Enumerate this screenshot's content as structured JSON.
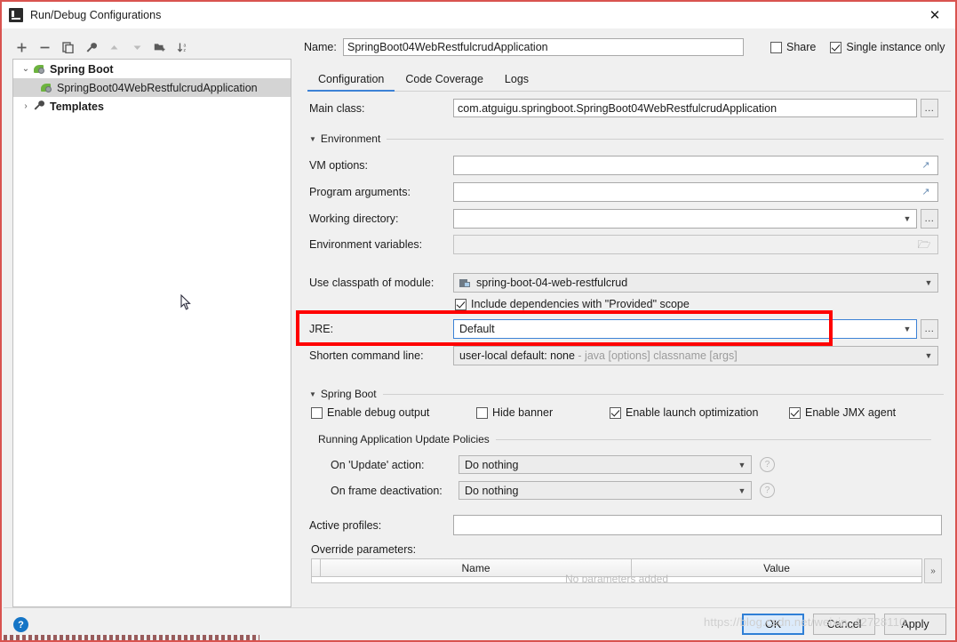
{
  "window": {
    "title": "Run/Debug Configurations",
    "app_icon": "intellij-idea-icon",
    "close_label": "✕"
  },
  "left_panel": {
    "toolbar": [
      {
        "name": "add-button",
        "glyph": "+"
      },
      {
        "name": "remove-button",
        "glyph": "−"
      },
      {
        "name": "copy-button",
        "glyph": "❐"
      },
      {
        "name": "edit-templates-button",
        "glyph": "🔧"
      },
      {
        "name": "move-up-button",
        "glyph": "▲"
      },
      {
        "name": "move-down-button",
        "glyph": "▼"
      },
      {
        "name": "new-folder-button",
        "glyph": "⬛"
      },
      {
        "name": "sort-button",
        "glyph": "↓"
      }
    ],
    "tree": [
      {
        "label": "Spring Boot",
        "icon": "spring-boot-icon",
        "twisty": "⌄",
        "bold": true,
        "selected": false,
        "indent": false
      },
      {
        "label": "SpringBoot04WebRestfulcrudApplication",
        "icon": "spring-boot-icon",
        "twisty": "",
        "bold": false,
        "selected": true,
        "indent": true
      },
      {
        "label": "Templates",
        "icon": "wrench-icon",
        "twisty": "›",
        "bold": true,
        "selected": false,
        "indent": false
      }
    ]
  },
  "name_row": {
    "label": "Name:",
    "value": "SpringBoot04WebRestfulcrudApplication",
    "share": {
      "label": "Share",
      "checked": false
    },
    "single_instance": {
      "label": "Single instance only",
      "checked": true
    }
  },
  "tabs": [
    {
      "label": "Configuration",
      "active": true
    },
    {
      "label": "Code Coverage",
      "active": false
    },
    {
      "label": "Logs",
      "active": false
    }
  ],
  "configuration": {
    "main_class": {
      "label": "Main class:",
      "value": "com.atguigu.springboot.SpringBoot04WebRestfulcrudApplication",
      "browse_label": "..."
    },
    "environment_section": {
      "title": "Environment",
      "vm_options": {
        "label": "VM options:",
        "value": "",
        "expand_icon": "expand-icon"
      },
      "program_arguments": {
        "label": "Program arguments:",
        "value": "",
        "expand_icon": "expand-icon"
      },
      "working_directory": {
        "label": "Working directory:",
        "value": "",
        "browse_label": "..."
      },
      "environment_variables": {
        "label": "Environment variables:",
        "value": "",
        "folder_icon": "folder-icon"
      }
    },
    "use_classpath_of_module": {
      "label": "Use classpath of module:",
      "value": "spring-boot-04-web-restfulcrud",
      "module_icon": "module-icon"
    },
    "include_provided": {
      "label": "Include dependencies with \"Provided\" scope",
      "checked": true
    },
    "jre": {
      "label": "JRE:",
      "value": "Default",
      "focused": true,
      "browse_label": "..."
    },
    "shorten_command_line": {
      "label": "Shorten command line:",
      "value": "user-local default: none",
      "hint": " - java [options] classname [args]"
    },
    "spring_boot_section": {
      "title": "Spring Boot",
      "checkboxes": [
        {
          "label": "Enable debug output",
          "checked": false,
          "name": "enable-debug-output-checkbox"
        },
        {
          "label": "Hide banner",
          "checked": false,
          "name": "hide-banner-checkbox"
        },
        {
          "label": "Enable launch optimization",
          "checked": true,
          "name": "enable-launch-optimization-checkbox"
        },
        {
          "label": "Enable JMX agent",
          "checked": true,
          "name": "enable-jmx-agent-checkbox"
        }
      ],
      "update_policies": {
        "title": "Running Application Update Policies",
        "on_update_action": {
          "label": "On 'Update' action:",
          "value": "Do nothing",
          "help": "?"
        },
        "on_frame_deactivation": {
          "label": "On frame deactivation:",
          "value": "Do nothing",
          "help": "?"
        }
      },
      "active_profiles": {
        "label": "Active profiles:",
        "value": ""
      },
      "override_parameters": {
        "label": "Override parameters:",
        "columns": [
          "",
          "Name",
          "Value"
        ],
        "empty_text": "No parameters added",
        "expand_label": "»"
      }
    }
  },
  "footer": {
    "help_label": "?",
    "buttons": [
      {
        "label": "OK",
        "name": "ok-button",
        "primary": true
      },
      {
        "label": "Cancel",
        "name": "cancel-button",
        "primary": false
      },
      {
        "label": "Apply",
        "name": "apply-button",
        "primary": false
      }
    ],
    "watermark": "https://blog.csdn.net/weixin_42728110"
  }
}
